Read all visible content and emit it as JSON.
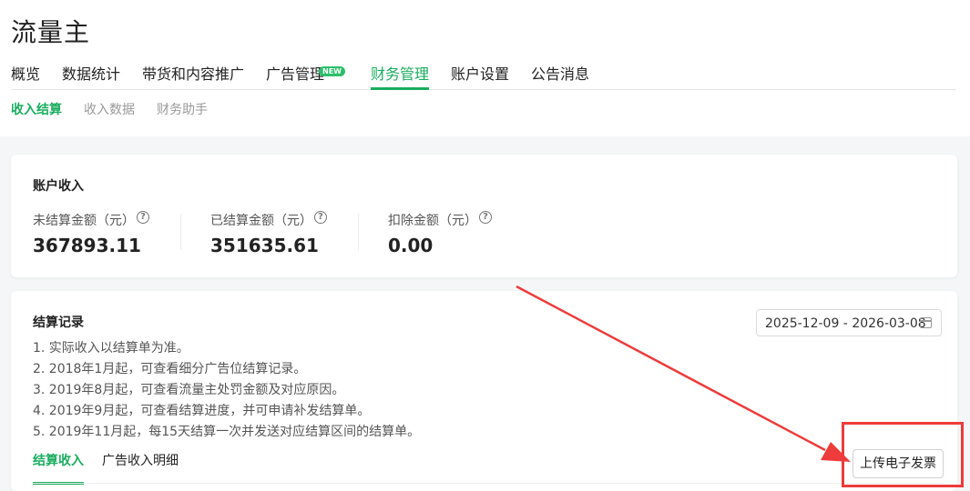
{
  "page": {
    "title": "流量主"
  },
  "main_tabs": [
    {
      "label": "概览"
    },
    {
      "label": "数据统计"
    },
    {
      "label": "带货和内容推广"
    },
    {
      "label": "广告管理",
      "badge": "NEW"
    },
    {
      "label": "财务管理",
      "active": true
    },
    {
      "label": "账户设置"
    },
    {
      "label": "公告消息"
    }
  ],
  "sub_tabs": [
    {
      "label": "收入结算",
      "active": true
    },
    {
      "label": "收入数据"
    },
    {
      "label": "财务助手"
    }
  ],
  "account_income": {
    "title": "账户收入",
    "stats": [
      {
        "label": "未结算金额（元）",
        "value": "367893.11",
        "icon": "help-circle-icon"
      },
      {
        "label": "已结算金额（元）",
        "value": "351635.61",
        "icon": "help-circle-icon"
      },
      {
        "label": "扣除金额（元）",
        "value": "0.00",
        "icon": "help-circle-icon"
      }
    ]
  },
  "settlement": {
    "title": "结算记录",
    "date_range": "2025-12-09 - 2026-03-08",
    "date_icon": "calendar-icon",
    "notes": [
      "1. 实际收入以结算单为准。",
      "2. 2018年1月起，可查看细分广告位结算记录。",
      "3. 2019年8月起，可查看流量主处罚金额及对应原因。",
      "4. 2019年9月起，可查看结算进度，并可申请补发结算单。",
      "5. 2019年11月起，每15天结算一次并发送对应结算区间的结算单。"
    ],
    "tabs": [
      {
        "label": "结算收入",
        "active": true
      },
      {
        "label": "广告收入明细"
      }
    ],
    "upload_button": "上传电子发票"
  },
  "colors": {
    "accent": "#1aad5f",
    "annotation": "#ee3b3b"
  }
}
